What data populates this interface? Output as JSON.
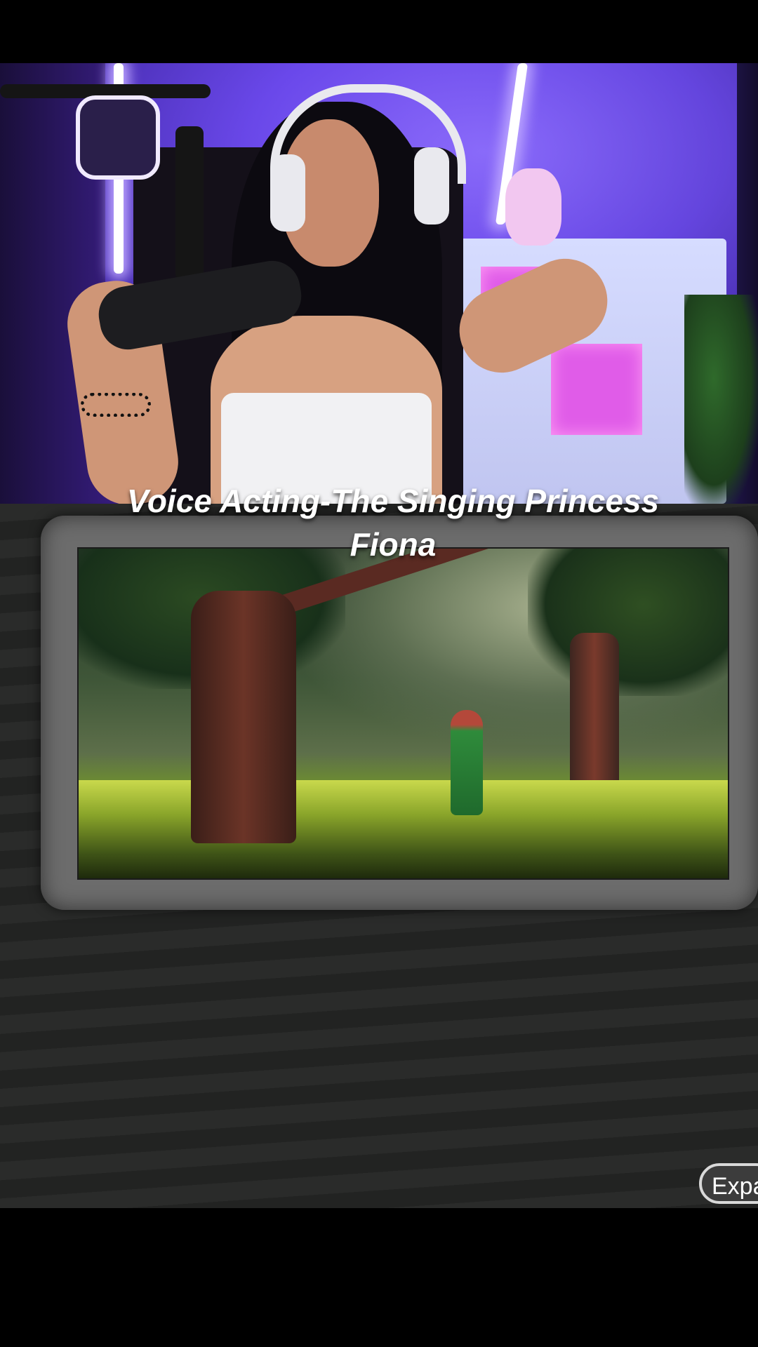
{
  "video": {
    "title": "Voice Acting-The Singing Princess Fiona"
  },
  "controls": {
    "expand_label": "Expa"
  },
  "colors": {
    "background": "#000000",
    "pattern_dark": "#222322",
    "pattern_light": "#2a2b2a",
    "frame": "#6c6c6c",
    "title_text": "#ffffff",
    "neon_purple": "#6a3ff0"
  },
  "icons": {
    "sticker": "mewtwo-sticker-icon"
  }
}
